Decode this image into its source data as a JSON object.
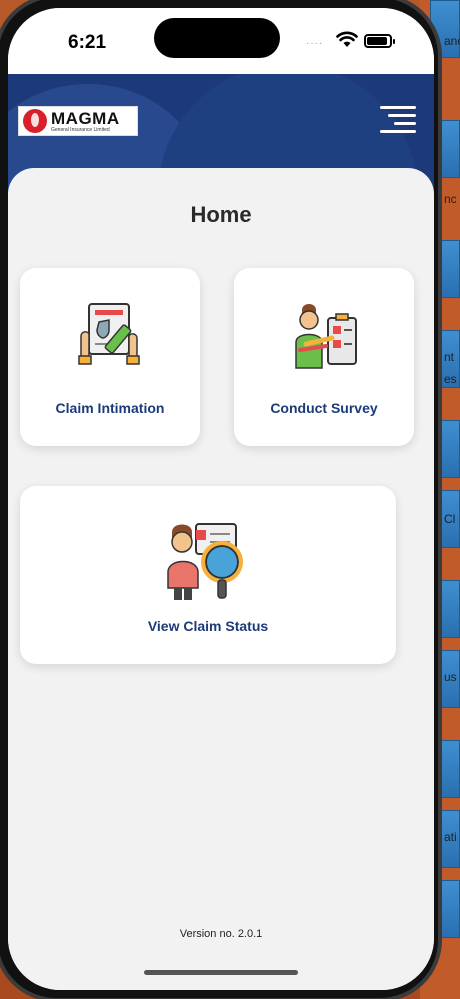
{
  "status_bar": {
    "time": "6:21",
    "signal_dots": "····"
  },
  "header": {
    "logo_name": "MAGMA",
    "logo_subtitle": "General Insurance Limited",
    "menu_icon": "hamburger-menu-icon",
    "brand_color": "#1c3a7a"
  },
  "page": {
    "title": "Home"
  },
  "cards": [
    {
      "label": "Claim Intimation",
      "icon": "claim-document-icon"
    },
    {
      "label": "Conduct Survey",
      "icon": "survey-checklist-icon"
    },
    {
      "label": "View Claim Status",
      "icon": "claim-status-search-icon"
    }
  ],
  "footer": {
    "version": "Version no. 2.0.1"
  },
  "background_window": {
    "fragments": [
      "anc",
      "nc",
      "nt",
      "es",
      "Cl",
      "us",
      "ati"
    ]
  }
}
